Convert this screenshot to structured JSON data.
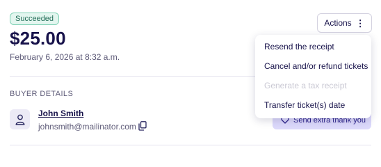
{
  "status_badge": "Succeeded",
  "amount": "$25.00",
  "date": "February 6, 2026 at 8:32 a.m.",
  "actions_button": "Actions",
  "actions_menu": {
    "items": [
      {
        "label": "Resend the receipt",
        "disabled": false
      },
      {
        "label": "Cancel and/or refund tickets",
        "disabled": false
      },
      {
        "label": "Generate a tax receipt",
        "disabled": true
      },
      {
        "label": "Transfer ticket(s) date",
        "disabled": false
      }
    ]
  },
  "buyer_details": {
    "section_title": "BUYER DETAILS",
    "name": "John Smith",
    "email": "johnsmith@mailinator.com",
    "send_thanks_button": "Send extra thank you"
  },
  "icons": {
    "avatar": "person-icon",
    "copy": "copy-icon",
    "kebab": "vertical-ellipsis-icon",
    "heart": "heart-icon"
  },
  "colors": {
    "success_badge_bg": "#e3f6ef",
    "success_badge_text": "#1f6b55",
    "primary_text": "#17124a",
    "secondary_button_bg": "#dcd9fb"
  }
}
